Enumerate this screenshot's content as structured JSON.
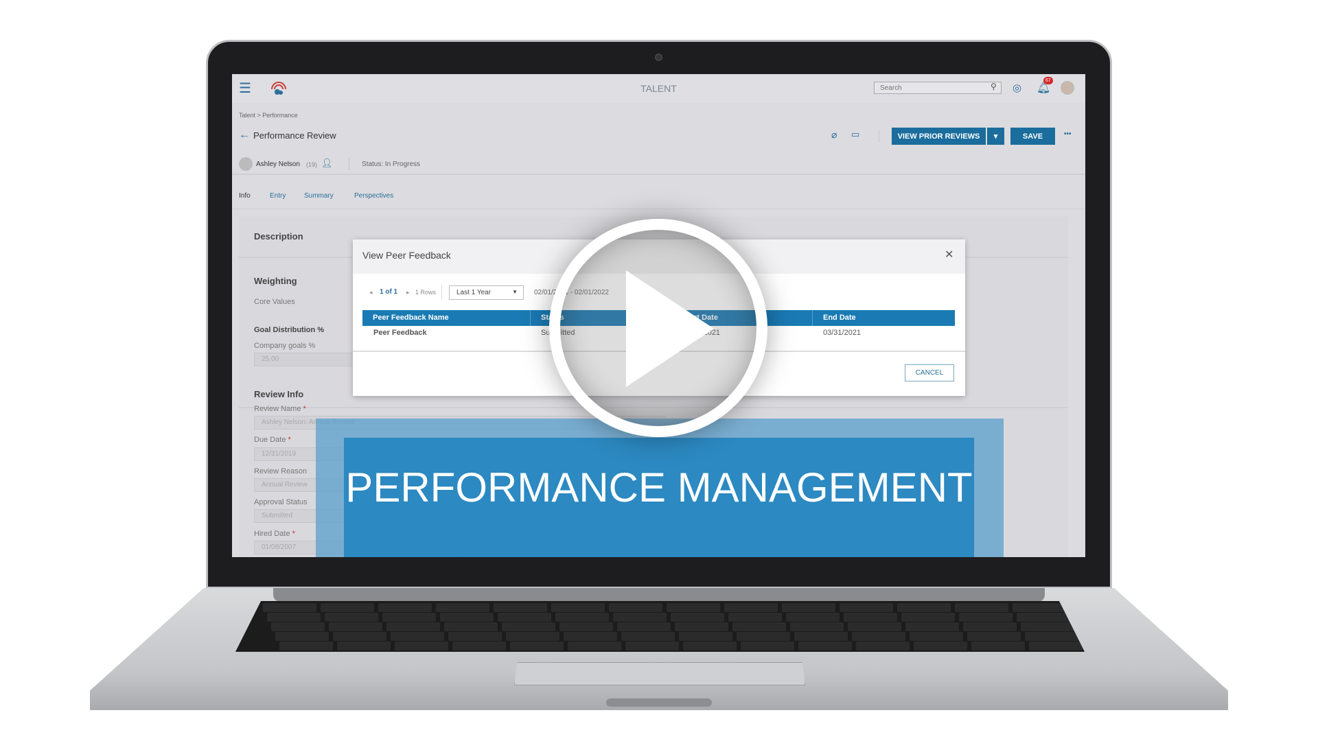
{
  "app": {
    "title": "TALENT",
    "search_placeholder": "Search",
    "notification_count": "67"
  },
  "breadcrumb": "Talent > Performance",
  "page": {
    "title": "Performance Review",
    "employee": "Ashley Nelson",
    "employee_id": "(19)",
    "status": "Status: In Progress"
  },
  "toolbar": {
    "view_prior": "VIEW PRIOR REVIEWS",
    "save": "SAVE",
    "more": "•••"
  },
  "tabs": [
    {
      "label": "Info"
    },
    {
      "label": "Entry"
    },
    {
      "label": "Summary"
    },
    {
      "label": "Perspectives"
    }
  ],
  "form": {
    "description": "Description",
    "weighting": "Weighting",
    "core_values": "Core Values",
    "goal_distribution": "Goal Distribution %",
    "company_goals": "Company goals %",
    "company_goals_value": "25.00",
    "review_info": "Review Info",
    "review_name": "Review Name",
    "review_name_value": "Ashley Nelson: Annual Review",
    "due_date": "Due Date",
    "due_date_value": "12/31/2019",
    "review_reason": "Review Reason",
    "review_reason_value": "Annual Review",
    "approval_status": "Approval Status",
    "approval_status_value": "Submitted",
    "hired_date": "Hired Date",
    "hired_date_value": "01/08/2007",
    "required_mark": "*"
  },
  "modal": {
    "title": "View Peer Feedback",
    "page": "1 of 1",
    "rows": "1 Rows",
    "range": "Last 1 Year",
    "date_range": "02/01/2021 - 02/01/2022",
    "columns": [
      "Peer Feedback Name",
      "Status",
      "Start Date",
      "End Date"
    ],
    "rows_data": [
      [
        "Peer Feedback",
        "Submitted",
        "03/01/2021",
        "03/31/2021"
      ]
    ],
    "cancel": "CANCEL"
  },
  "overlay": {
    "banner": "PERFORMANCE MANAGEMENT"
  },
  "colors": {
    "accent": "#1a6d9c",
    "table_header": "#1a7ab3",
    "banner": "#1e82be",
    "badge": "#d42a2a"
  }
}
